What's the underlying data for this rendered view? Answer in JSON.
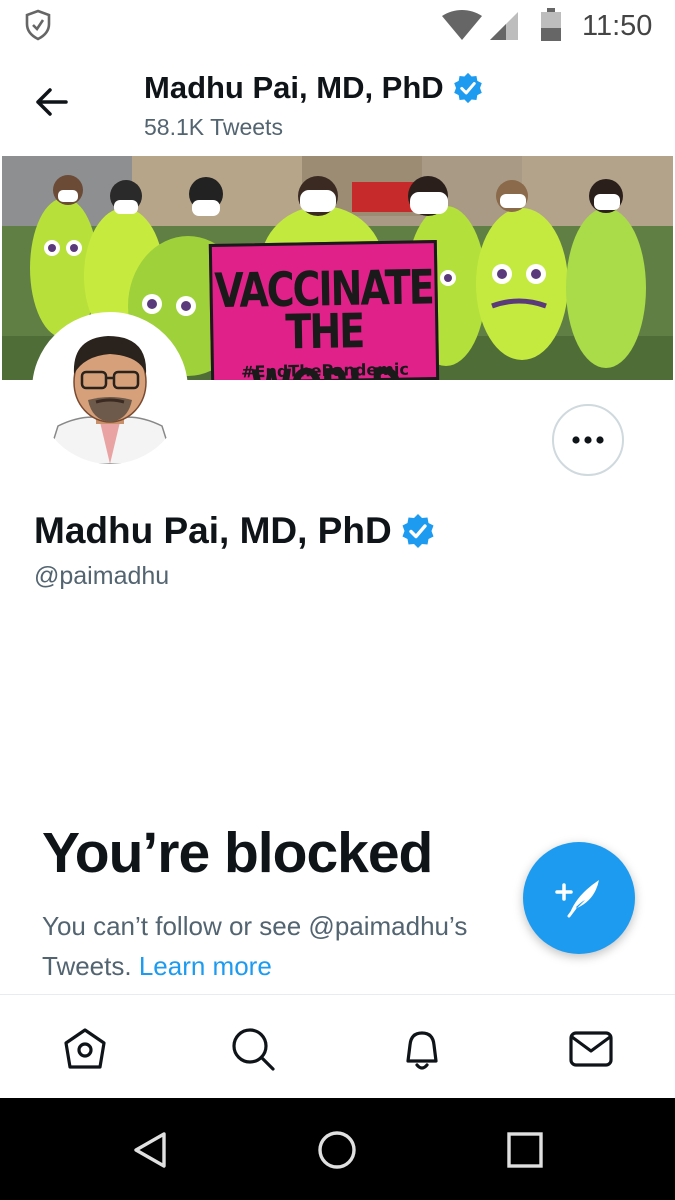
{
  "status_bar": {
    "time": "11:50",
    "icons": [
      "shield-check-icon",
      "wifi-icon",
      "signal-icon",
      "battery-icon"
    ]
  },
  "header": {
    "name": "Madhu Pai, MD, PhD",
    "tweet_count": "58.1K Tweets",
    "back_icon": "back-arrow-icon",
    "verified": true
  },
  "banner": {
    "sign_line1": "VACCINATE",
    "sign_line2": "THE WORLD",
    "sign_line3": "#EndThePandemic"
  },
  "profile": {
    "name": "Madhu Pai, MD, PhD",
    "handle": "@paimadhu",
    "verified": true,
    "more_icon": "more-options-icon"
  },
  "blocked": {
    "title": "You’re blocked",
    "message": "You can’t follow or see @paimadhu’s Tweets.",
    "learn_more": "Learn more"
  },
  "compose": {
    "icon": "compose-tweet-icon"
  },
  "bottom_nav": {
    "items": [
      "home-icon",
      "search-icon",
      "notifications-icon",
      "messages-icon"
    ]
  },
  "android_nav": {
    "items": [
      "back-triangle-icon",
      "home-circle-icon",
      "recents-square-icon"
    ]
  },
  "colors": {
    "accent": "#1d9bf0",
    "text_primary": "#0f1419",
    "text_secondary": "#536471",
    "sign_pink": "#e0218a"
  }
}
